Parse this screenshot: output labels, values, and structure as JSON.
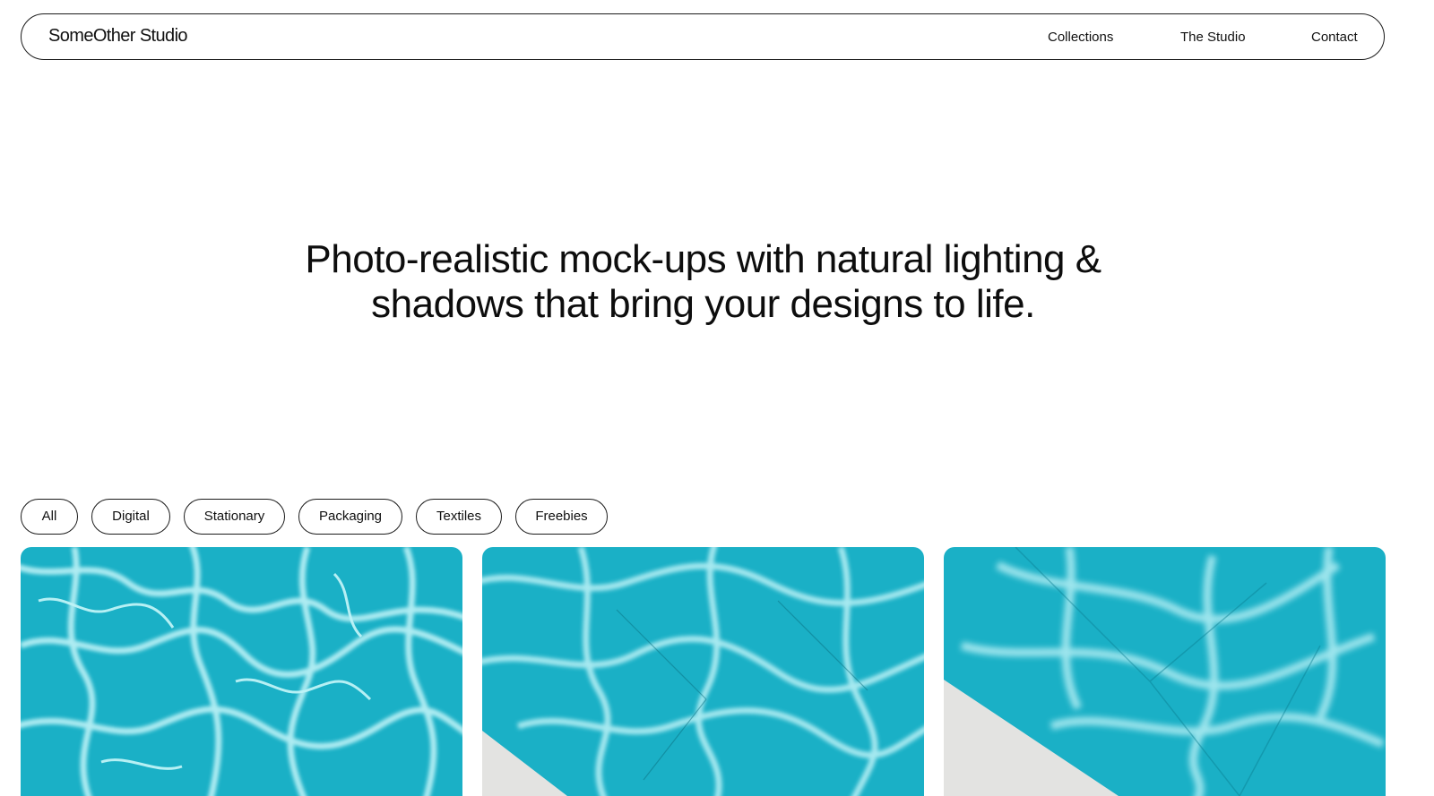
{
  "header": {
    "brand": "SomeOther Studio",
    "links": [
      "Collections",
      "The Studio",
      "Contact"
    ]
  },
  "hero": {
    "line1": "Photo-realistic mock-ups with natural lighting &",
    "line2": "shadows that bring your designs to life."
  },
  "filters": [
    "All",
    "Digital",
    "Stationary",
    "Packaging",
    "Textiles",
    "Freebies"
  ],
  "colors": {
    "water": "#1ab0c6",
    "water_deep": "#0a95ab",
    "caustic": "#bff3f7",
    "concrete": "#e3e3e1",
    "outline": "#1a1a1a"
  }
}
